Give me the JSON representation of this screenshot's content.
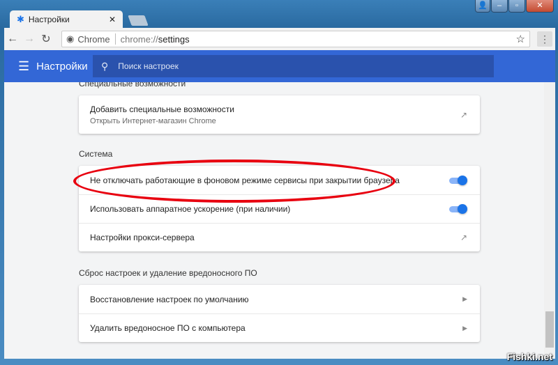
{
  "window": {
    "controls": [
      "user",
      "minimize",
      "maximize",
      "close"
    ]
  },
  "tab": {
    "title": "Настройки",
    "icon": "gear-icon"
  },
  "toolbar": {
    "origin": "Chrome",
    "url_prefix": "chrome://",
    "url_path": "settings"
  },
  "header": {
    "title": "Настройки",
    "search_placeholder": "Поиск настроек"
  },
  "sections": [
    {
      "title": "Специальные возможности",
      "rows": [
        {
          "label": "Добавить специальные возможности",
          "sub": "Открыть Интернет-магазин Chrome",
          "control": "external-link"
        }
      ]
    },
    {
      "title": "Система",
      "rows": [
        {
          "label": "Не отключать работающие в фоновом режиме сервисы при закрытии браузера",
          "control": "toggle",
          "on": true,
          "highlighted": true
        },
        {
          "label": "Использовать аппаратное ускорение (при наличии)",
          "control": "toggle",
          "on": true
        },
        {
          "label": "Настройки прокси-сервера",
          "control": "external-link"
        }
      ]
    },
    {
      "title": "Сброс настроек и удаление вредоносного ПО",
      "rows": [
        {
          "label": "Восстановление настроек по умолчанию",
          "control": "arrow"
        },
        {
          "label": "Удалить вредоносное ПО с компьютера",
          "control": "arrow"
        }
      ]
    }
  ],
  "colors": {
    "accent": "#3367d6",
    "toggle": "#1a73e8",
    "highlight": "#e8000f"
  },
  "watermark": "Fishki.net"
}
